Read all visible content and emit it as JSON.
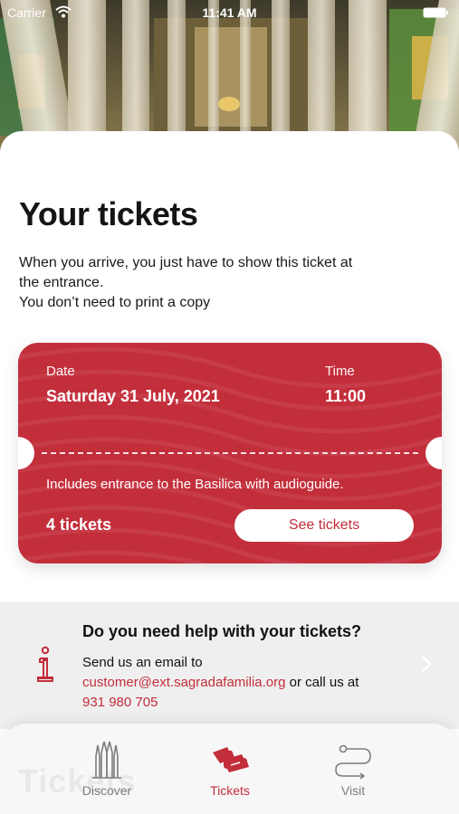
{
  "status_bar": {
    "carrier": "Carrier",
    "time": "11:41 AM"
  },
  "page": {
    "title": "Your tickets",
    "intro_lines": [
      "When you arrive, you just have to show this ticket at",
      "the entrance.",
      "You don’t need to print a copy"
    ]
  },
  "ticket": {
    "date_label": "Date",
    "date_value": "Saturday 31 July, 2021",
    "time_label": "Time",
    "time_value": "11:00",
    "includes": "Includes entrance to the Basilica with audioguide.",
    "count": "4 tickets",
    "button_label": "See tickets",
    "color": "#c32e3b"
  },
  "help": {
    "title": "Do you need help with your tickets?",
    "line1": "Send us an email to",
    "email": "customer@ext.sagradafamilia.org",
    "or_call": " or call us at",
    "phone": "931 980 705"
  },
  "tabbar": {
    "watermark": "Tickets",
    "tabs": [
      {
        "label": "Discover",
        "icon": "basilica-icon",
        "active": false
      },
      {
        "label": "Tickets",
        "icon": "tickets-icon",
        "active": true
      },
      {
        "label": "Visit",
        "icon": "route-icon",
        "active": false
      }
    ]
  }
}
